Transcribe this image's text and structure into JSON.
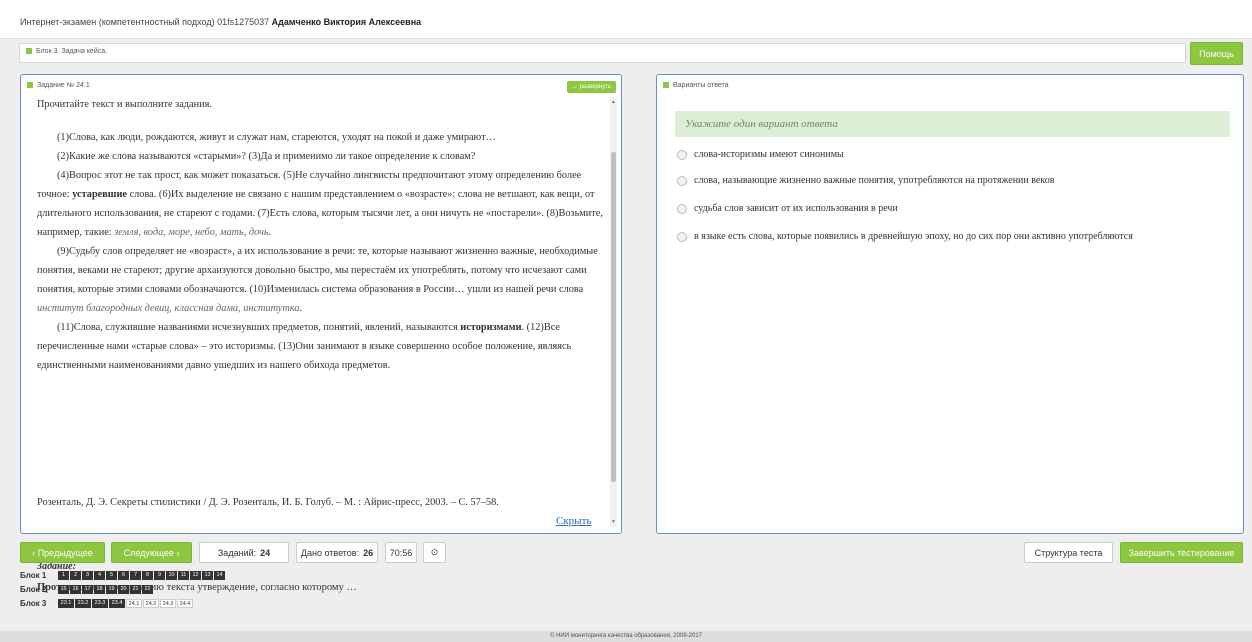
{
  "header": {
    "title_prefix": "Интернет-экзамен (компетентностный подход) 01fs1275037",
    "user_name": "Адамченко Виктория Алексеевна"
  },
  "block_bar": {
    "label": "Блок 3. Задача кейса.",
    "help_label": "Помощь"
  },
  "task_panel": {
    "header": "Задание № 24.1",
    "expand_label": "развернуть",
    "intro": "Прочитайте текст и выполните задания.",
    "p1": "(1)Слова, как люди, рождаются, живут и служат нам, стареются, уходят на покой и даже умирают…",
    "p2": "(2)Какие же слова называются «старыми»? (3)Да и применимо ли такое определение к словам?",
    "p3_a": "(4)Вопрос этот не так прост, как может показаться. (5)Не случайно лингвисты предпочитают этому определению более точное: ",
    "p3_b": "устаревшие",
    "p3_c": " слова. (6)Их выделение не связано с нашим представлением о «возрасте»: слова не ветшают, как вещи, от длительного использования, не стареют с годами. (7)Есть слова, которым тысячи лет, а они ничуть не «постарели». (8)Возьмите, например, такие: ",
    "p3_d": "земля, вода, море, небо, мать, дочь",
    "p3_e": ".",
    "p4_a": "(9)Судьбу слов определяет не «возраст», а их использование в речи: те, которые называют жизненно важные, необходимые понятия, веками не стареют; другие архаизуются довольно быстро, мы перестаём их употреблять, потому что исчезают сами понятия, которые этими словами обозначаются. (10)Изменилась система образования в России… ушли из нашей речи слова ",
    "p4_b": "институт благородных девиц, классная дама, институтка",
    "p4_c": ".",
    "p5_a": "(11)Слова, служившие названиями исчезнувших предметов, понятий, явлений, называются ",
    "p5_b": "историзмами",
    "p5_c": ". (12)Все перечисленные нами «старые слова» – это историзмы. (13)Они занимают в языке совершенно особое положение, являясь единственными наименованиями давно ушедших из нашего обихода предметов.",
    "source": "Розенталь, Д. Э. Секреты стилистики / Д. Э. Розенталь, И. Б. Голуб. – М. : Айрис-пресс, 2003. – С. 57–58.",
    "hide_label": "Скрыть",
    "task_title": "Задание:",
    "task_bold": "Противоречит",
    "task_rest": " содержанию текста утверждение, согласно которому …"
  },
  "answers_panel": {
    "header": "Варианты ответа",
    "hint": "Укажите один вариант ответа",
    "options": [
      "слова-историзмы имеют синонимы",
      "слова, называющие жизненно важные понятия, употребляются на протяжении веков",
      "судьба слов зависит от их использования в речи",
      "в языке есть слова, которые появились в древнейшую эпоху, но до сих пор они активно употребляются"
    ]
  },
  "nav": {
    "prev_label": "Предыдущее",
    "next_label": "Следующее",
    "tasks_label": "Заданий:",
    "tasks_count": "24",
    "answers_label": "Дано ответов:",
    "answers_count": "26",
    "timer": "70:56",
    "structure_label": "Структура теста",
    "finish_label": "Завершить тестирование"
  },
  "blocks": [
    {
      "label": "Блок 1",
      "items": [
        "1",
        "2",
        "3",
        "4",
        "5",
        "6",
        "7",
        "8",
        "9",
        "10",
        "11",
        "12",
        "13",
        "14"
      ],
      "done": 14
    },
    {
      "label": "Блок 2",
      "items": [
        "15",
        "16",
        "17",
        "18",
        "19",
        "20",
        "21",
        "22"
      ],
      "done": 8
    },
    {
      "label": "Блок 3",
      "items": [
        "23.1",
        "23.2",
        "23.3",
        "23.4",
        "24.1",
        "24.2",
        "24.3",
        "24.4"
      ],
      "done": 4
    }
  ],
  "footer": "© НИИ мониторинга качества образования, 2008-2017"
}
